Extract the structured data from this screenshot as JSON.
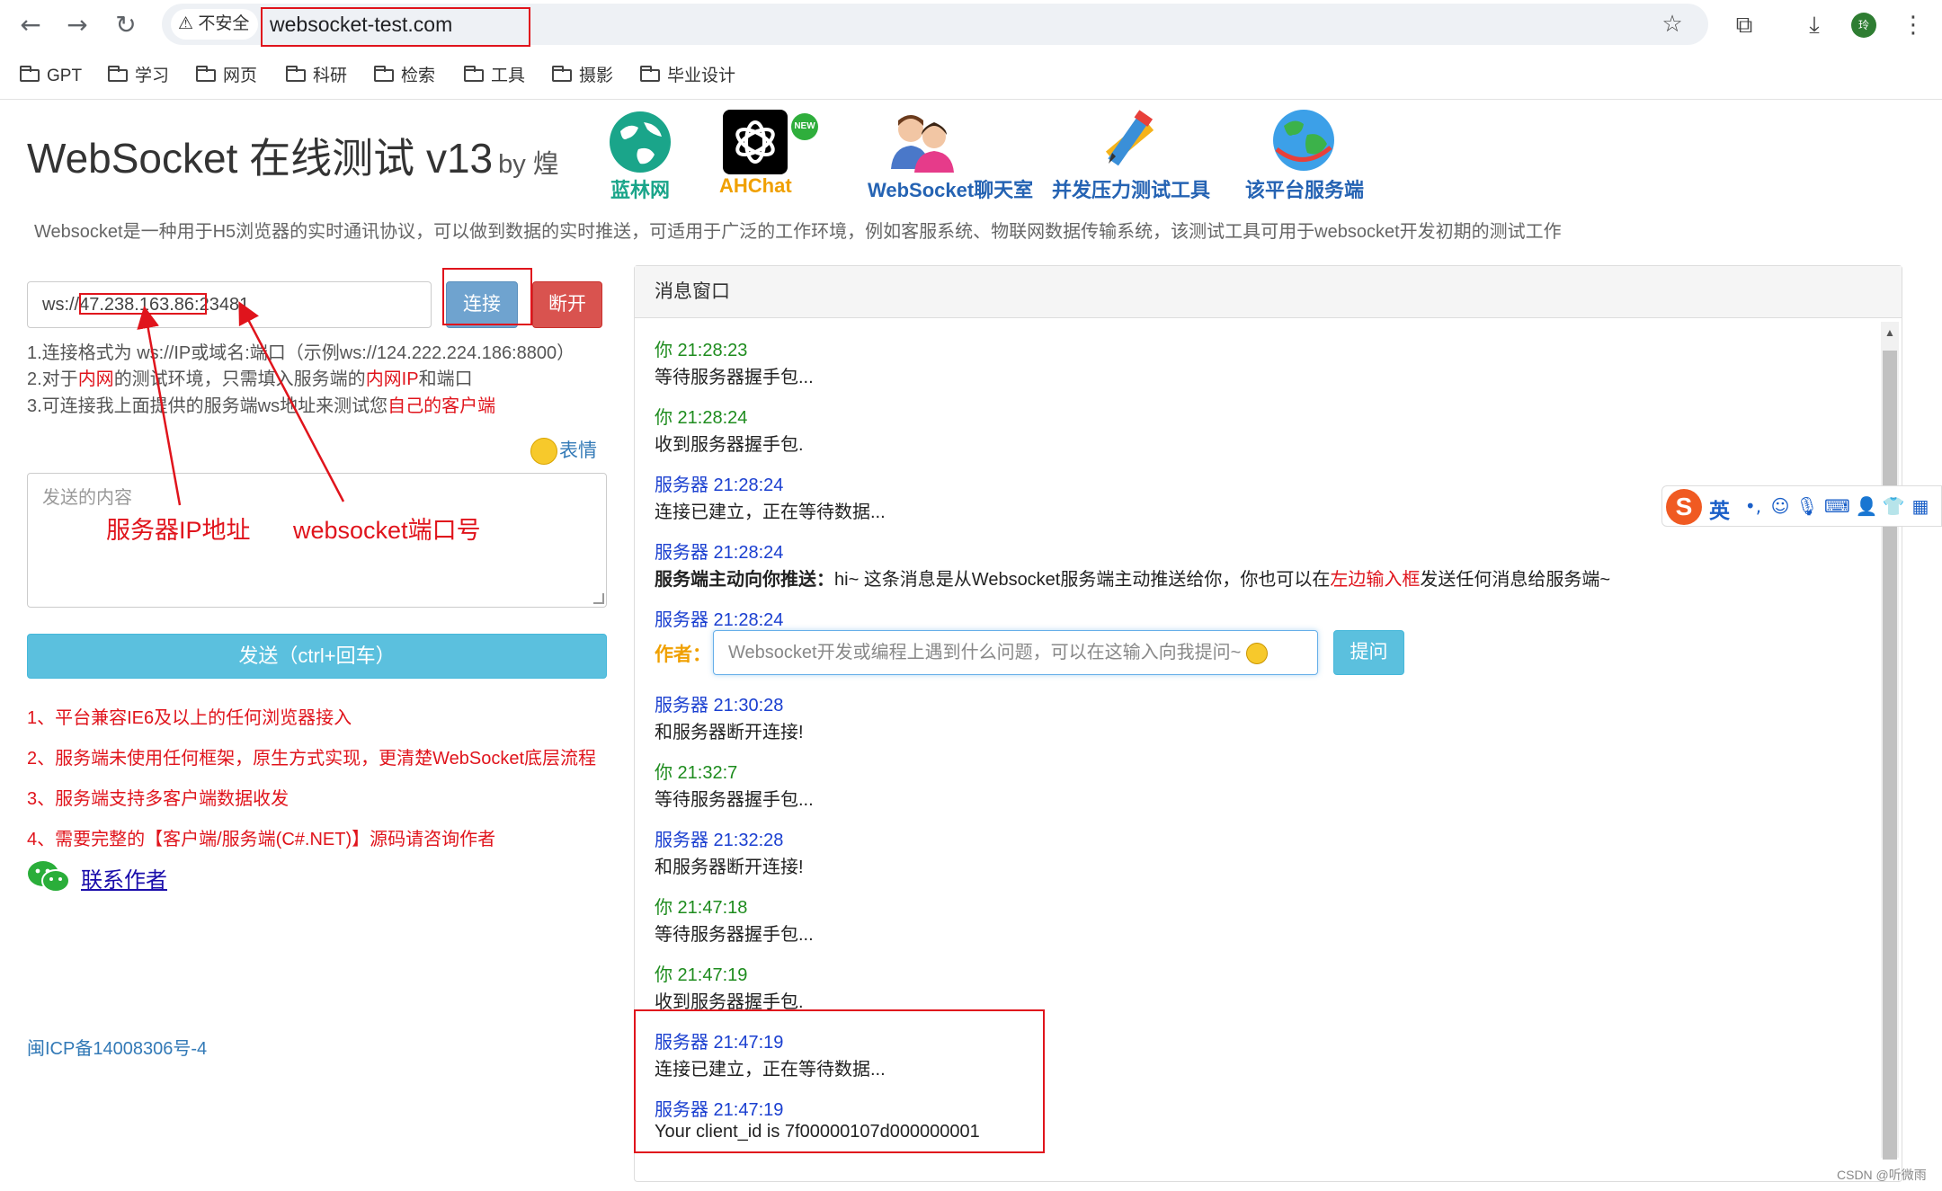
{
  "browser": {
    "security_label": "不安全",
    "url": "websocket-test.com",
    "avatar_letter": "玲",
    "bookmarks": [
      "GPT",
      "学习",
      "网页",
      "科研",
      "检索",
      "工具",
      "摄影",
      "毕业设计"
    ]
  },
  "header": {
    "title": "WebSocket 在线测试 v13",
    "byline": "by 煌",
    "nav": [
      "蓝林网",
      "AHChat",
      "WebSocket聊天室",
      "并发压力测试工具",
      "该平台服务端"
    ],
    "new_badge": "NEW",
    "description": "Websocket是一种用于H5浏览器的实时通讯协议，可以做到数据的实时推送，可适用于广泛的工作环境，例如客服系统、物联网数据传输系统，该测试工具可用于websocket开发初期的测试工作"
  },
  "connection": {
    "url_value": "ws://47.238.163.86:23481",
    "connect_label": "连接",
    "disconnect_label": "断开",
    "hint1": "1.连接格式为 ws://IP或域名:端口（示例ws://124.222.224.186:8800）",
    "hint2_a": "2.对于",
    "hint2_b": "内网",
    "hint2_c": "的测试环境，只需填入服务端的",
    "hint2_d": "内网IP",
    "hint2_e": "和端口",
    "hint3_a": "3.可连接我上面提供的服务端ws地址来测试您",
    "hint3_b": "自己的客户端"
  },
  "composer": {
    "emoji_label": "表情",
    "placeholder": "发送的内容",
    "send_label": "发送（ctrl+回车）"
  },
  "annotations": {
    "ip_label": "服务器IP地址",
    "port_label": "websocket端口号"
  },
  "features": [
    "1、平台兼容IE6及以上的任何浏览器接入",
    "2、服务端未使用任何框架，原生方式实现，更清楚WebSocket底层流程",
    "3、服务端支持多客户端数据收发",
    "4、需要完整的【客户端/服务端(C#.NET)】源码请咨询作者"
  ],
  "contact_label": "联系作者",
  "icp": "闽ICP备14008306号-4",
  "messages_panel": {
    "title": "消息窗口",
    "push_bold": "服务端主动向你推送：",
    "push_text_a": "hi~ 这条消息是从Websocket服务端主动推送给你，你也可以在",
    "push_text_red": "左边输入框",
    "push_text_b": "发送任何消息给服务端~",
    "author_label": "作者：",
    "ask_placeholder": "Websocket开发或编程上遇到什么问题，可以在这输入向我提问~",
    "ask_button": "提问",
    "messages": [
      {
        "head": "你 21:28:23",
        "body": "等待服务器握手包..."
      },
      {
        "head": "你 21:28:24",
        "body": "收到服务器握手包."
      },
      {
        "head": "服务器 21:28:24",
        "body": "连接已建立，正在等待数据..."
      },
      {
        "head": "服务器 21:28:24"
      },
      {
        "head": "服务器 21:28:24"
      },
      {
        "head": "服务器 21:30:28",
        "body": "和服务器断开连接!"
      },
      {
        "head": "你 21:32:7",
        "body": "等待服务器握手包..."
      },
      {
        "head": "服务器 21:32:28",
        "body": "和服务器断开连接!"
      },
      {
        "head": "你 21:47:18",
        "body": "等待服务器握手包..."
      },
      {
        "head": "你 21:47:19",
        "body": "收到服务器握手包."
      },
      {
        "head": "服务器 21:47:19",
        "body": "连接已建立，正在等待数据..."
      },
      {
        "head": "服务器 21:47:19",
        "body": "Your client_id is 7f00000107d000000001"
      }
    ]
  },
  "ime": {
    "logo": "S",
    "lang": "英"
  },
  "watermark": "CSDN @听微雨",
  "colors": {
    "accent_red": "#e0141c",
    "info_button": "#5bc0de",
    "you_green": "#1e8c1e",
    "server_blue": "#1a3fd0"
  }
}
